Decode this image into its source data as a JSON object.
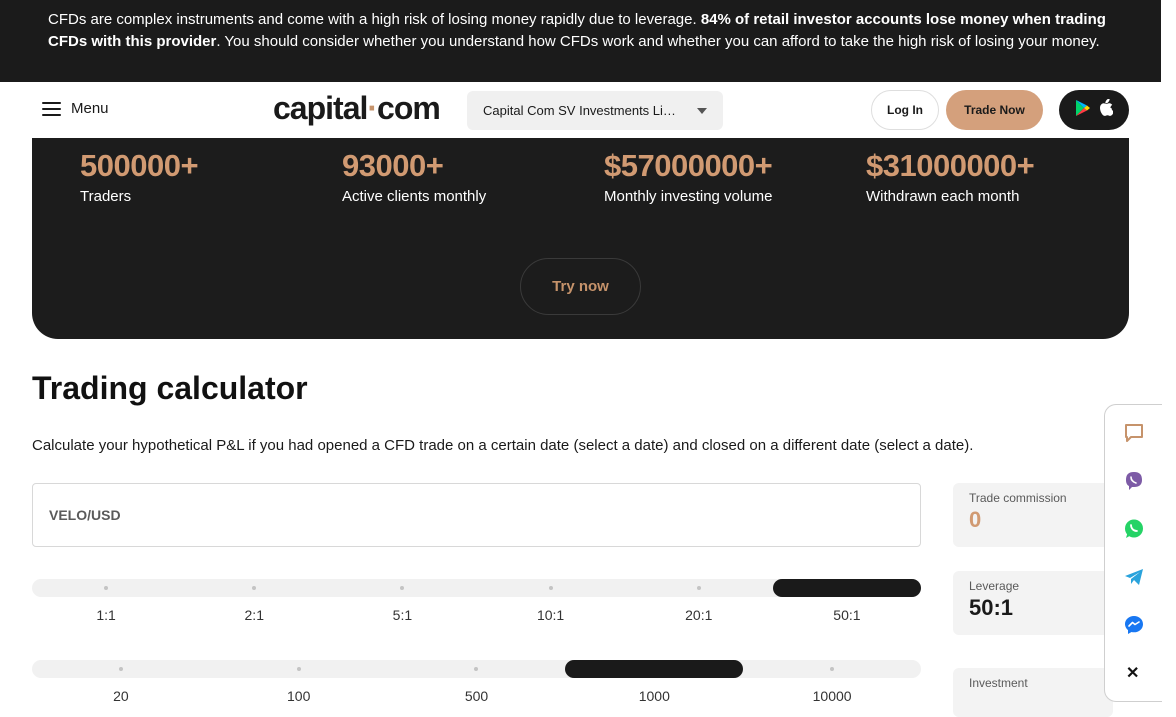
{
  "risk_banner": {
    "text_1": "CFDs are complex instruments and come with a high risk of losing money rapidly due to leverage. ",
    "text_bold": "84% of retail investor accounts lose money when trading CFDs with this provider",
    "text_2": ". You should consider whether you understand how CFDs work and whether you can afford to take the high risk of losing your money."
  },
  "header": {
    "menu_label": "Menu",
    "logo_part1": "capital",
    "logo_dot": "·",
    "logo_part2": "com",
    "entity_select_value": "Capital Com SV Investments Limited",
    "login_label": "Log In",
    "trade_label": "Trade Now"
  },
  "stats": [
    {
      "number": "500000+",
      "label": "Traders"
    },
    {
      "number": "93000+",
      "label": "Active clients monthly"
    },
    {
      "number": "$57000000+",
      "label": "Monthly investing volume"
    },
    {
      "number": "$31000000+",
      "label": "Withdrawn each month"
    }
  ],
  "try_now_label": "Try now",
  "calculator": {
    "title": "Trading calculator",
    "description": "Calculate your hypothetical P&L if you had opened a CFD trade on a certain date (select a date) and closed on a different date (select a date).",
    "instrument": "VELO/USD",
    "leverage_options": [
      "1:1",
      "2:1",
      "5:1",
      "10:1",
      "20:1",
      "50:1"
    ],
    "leverage_selected": "50:1",
    "investment_options": [
      "20",
      "100",
      "500",
      "1000",
      "10000"
    ],
    "investment_selected": "1000",
    "trade_commission_label": "Trade commission",
    "trade_commission_value": "0",
    "leverage_label": "Leverage",
    "leverage_value": "50:1",
    "investment_label": "Investment"
  },
  "colors": {
    "accent": "#d19a72",
    "dark": "#1c1c1c",
    "trade_button": "#d4a07c"
  },
  "chat_widget_icons": [
    "chat-bubble-icon",
    "viber-icon",
    "whatsapp-icon",
    "telegram-icon",
    "messenger-icon",
    "close-icon"
  ]
}
